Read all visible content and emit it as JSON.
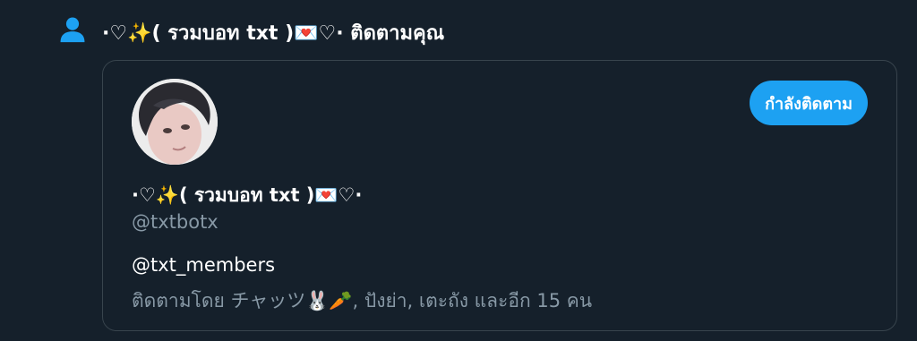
{
  "notification": {
    "icon": "person-icon",
    "actor_name": "·♡✨( รวมบอท txt )💌♡·",
    "action_text": "ติดตามคุณ"
  },
  "user_card": {
    "display_name": "·♡✨( รวมบอท txt )💌♡·",
    "handle": "@txtbotx",
    "bio": "@txt_members",
    "followed_by": "ติดตามโดย チャッツ🐰🥕, ปังย่า, เตะถัง และอีก 15 คน",
    "follow_button_label": "กำลังติดตาม"
  },
  "colors": {
    "background": "#15202b",
    "accent": "#1da1f2",
    "secondary_text": "#8899a6",
    "border": "#38444d"
  }
}
